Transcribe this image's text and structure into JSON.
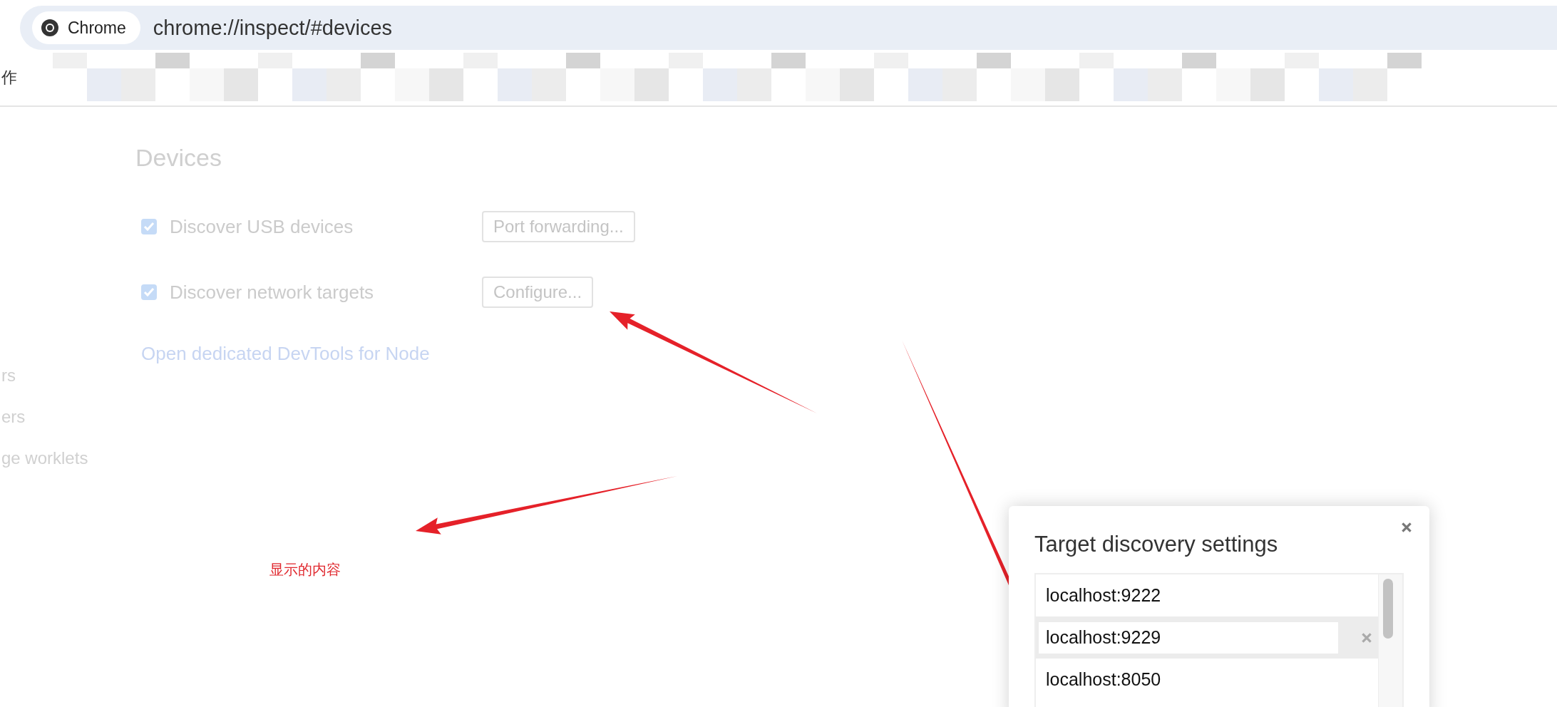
{
  "address_bar": {
    "chip": "Chrome",
    "url": "chrome://inspect/#devices"
  },
  "bookmarks_bar": {
    "items": [
      {
        "label": "作"
      }
    ]
  },
  "sidebar": {
    "items": [
      {
        "label": "rs"
      },
      {
        "label": "ers"
      },
      {
        "label": "ge worklets"
      }
    ]
  },
  "page": {
    "title": "Devices",
    "options": [
      {
        "label": "Discover USB devices",
        "checked": true,
        "button": "Port forwarding..."
      },
      {
        "label": "Discover network targets",
        "checked": true,
        "button": "Configure..."
      }
    ],
    "link": "Open dedicated DevTools for Node"
  },
  "annotation": {
    "text": "显示的内容"
  },
  "dialog": {
    "title": "Target discovery settings",
    "targets": [
      {
        "value": "localhost:9222",
        "selected": false
      },
      {
        "value": "localhost:9229",
        "selected": true
      },
      {
        "value": "localhost:8050",
        "selected": false
      }
    ]
  }
}
